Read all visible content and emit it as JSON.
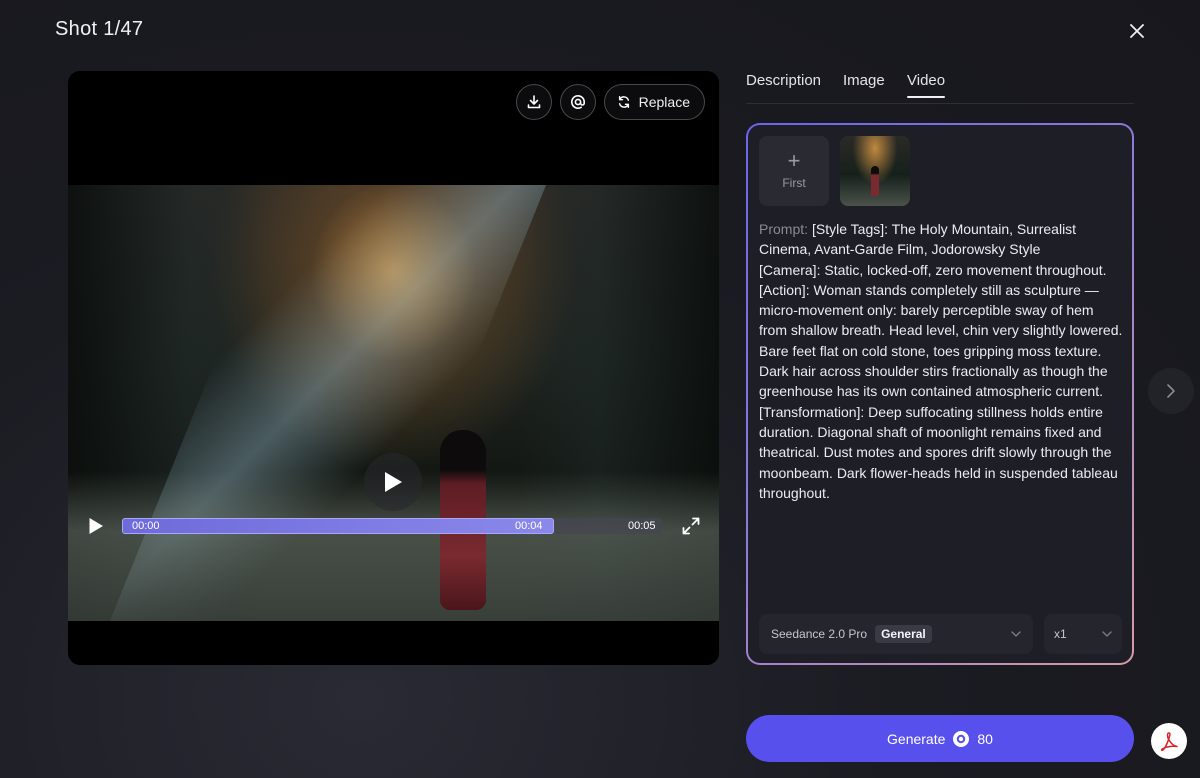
{
  "header": {
    "title": "Shot 1/47",
    "close_icon": "close-icon"
  },
  "player": {
    "tools": {
      "download_icon": "download-icon",
      "mention_icon": "at-icon",
      "replace_label": "Replace",
      "replace_icon": "refresh-icon"
    },
    "current_time": "00:00",
    "buffered_time": "00:04",
    "duration": "00:05",
    "progress_fraction": 0.8
  },
  "tabs": [
    {
      "label": "Description",
      "active": false
    },
    {
      "label": "Image",
      "active": false
    },
    {
      "label": "Video",
      "active": true
    }
  ],
  "card": {
    "first_slot_label": "First",
    "prompt_label": "Prompt:",
    "prompt_lines": [
      "[Style Tags]: The Holy Mountain, Surrealist Cinema, Avant-Garde Film, Jodorowsky Style",
      "[Camera]: Static, locked-off, zero movement throughout.",
      "[Action]: Woman stands completely still as sculpture — micro-movement only: barely perceptible sway of hem from shallow breath. Head level, chin very slightly lowered. Bare feet flat on cold stone, toes gripping moss texture. Dark hair across shoulder stirs fractionally as though the greenhouse has its own contained atmospheric current.",
      "[Transformation]: Deep suffocating stillness holds entire duration. Diagonal shaft of moonlight remains fixed and theatrical. Dust motes and spores drift slowly through the moonbeam. Dark flower-heads held in suspended tableau throughout."
    ],
    "model_name": "Seedance 2.0 Pro",
    "model_badge": "General",
    "count": "x1"
  },
  "generate": {
    "label": "Generate",
    "credits": "80"
  },
  "colors": {
    "accent": "#5850ec",
    "background": "#1b1b22"
  }
}
